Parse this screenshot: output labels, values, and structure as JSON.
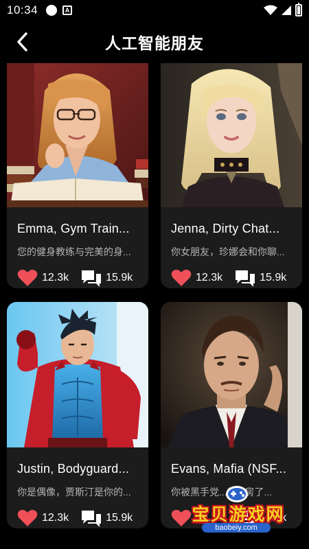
{
  "status_bar": {
    "time": "10:34",
    "a_icon_label": "A"
  },
  "header": {
    "title": "人工智能朋友",
    "back_icon": "chevron-left-icon"
  },
  "cards": [
    {
      "name": "Emma, Gym Train...",
      "description": "您的健身教练与完美的身...",
      "likes": "12.3k",
      "comments": "15.9k"
    },
    {
      "name": "Jenna, Dirty Chat...",
      "description": "你女朋友，珍娜会和你聊...",
      "likes": "12.3k",
      "comments": "15.9k"
    },
    {
      "name": "Justin, Bodyguard...",
      "description": "你是偶像，贾斯汀是你的...",
      "likes": "12.3k",
      "comments": "15.9k"
    },
    {
      "name": "Evans, Mafia (NSF...",
      "description": "你被黑手党...新...房了...",
      "likes": "12.3k",
      "comments": "15.9k"
    }
  ],
  "watermark": {
    "text": "宝贝游戏网",
    "url": "baobeiy.com"
  },
  "colors": {
    "background": "#000000",
    "card": "#1c1c1c",
    "heart": "#f0505a",
    "watermark_yellow": "#f5d020",
    "watermark_red": "#c8121e"
  }
}
